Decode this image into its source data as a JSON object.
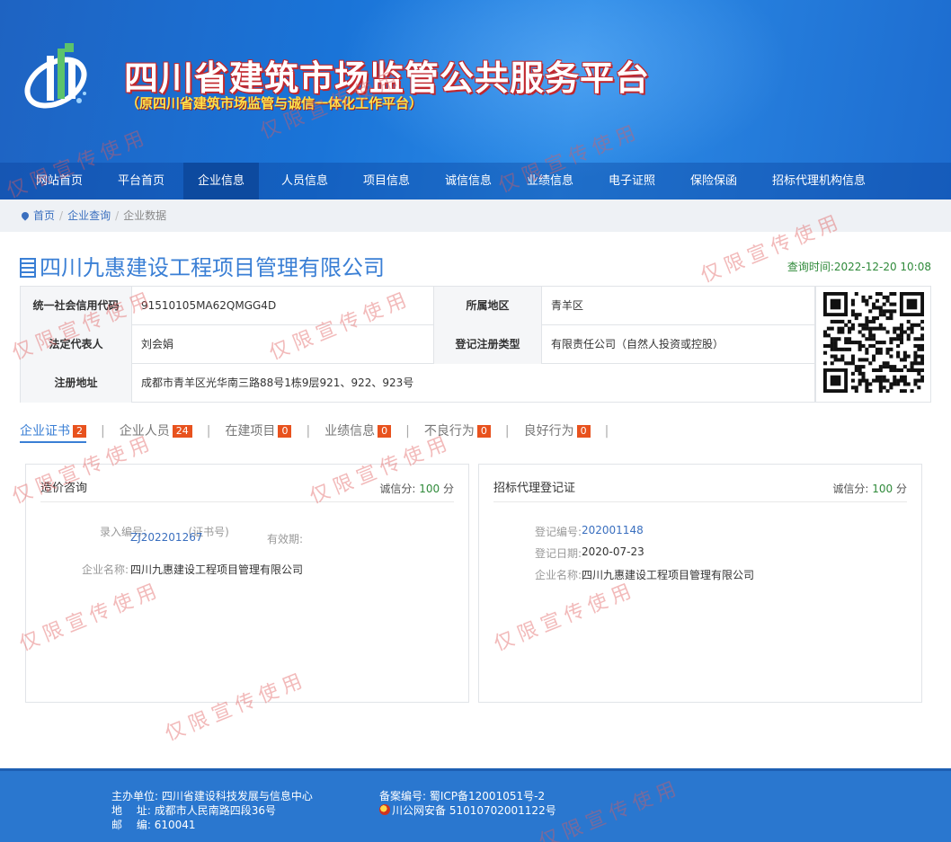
{
  "header": {
    "title": "四川省建筑市场监管公共服务平台",
    "subtitle": "（原四川省建筑市场监管与诚信一体化工作平台）"
  },
  "nav": {
    "items": [
      {
        "label": "网站首页",
        "active": false
      },
      {
        "label": "平台首页",
        "active": false
      },
      {
        "label": "企业信息",
        "active": true
      },
      {
        "label": "人员信息",
        "active": false
      },
      {
        "label": "项目信息",
        "active": false
      },
      {
        "label": "诚信信息",
        "active": false
      },
      {
        "label": "业绩信息",
        "active": false
      },
      {
        "label": "电子证照",
        "active": false
      },
      {
        "label": "保险保函",
        "active": false
      },
      {
        "label": "招标代理机构信息",
        "active": false
      }
    ]
  },
  "breadcrumb": {
    "home": "首页",
    "query": "企业查询",
    "current": "企业数据",
    "separator": "/"
  },
  "company": {
    "name": "四川九惠建设工程项目管理有限公司",
    "query_time": "查询时间:2022-12-20 10:08"
  },
  "info": {
    "credit_code_label": "统一社会信用代码",
    "credit_code": "91510105MA62QMGG4D",
    "region_label": "所属地区",
    "region": "青羊区",
    "legal_rep_label": "法定代表人",
    "legal_rep": "刘会娟",
    "reg_type_label": "登记注册类型",
    "reg_type": "有限责任公司（自然人投资或控股）",
    "address_label": "注册地址",
    "address": "成都市青羊区光华南三路88号1栋9层921、922、923号"
  },
  "tabs": [
    {
      "label": "企业证书",
      "count": "2",
      "active": true
    },
    {
      "label": "企业人员",
      "count": "24",
      "active": false
    },
    {
      "label": "在建项目",
      "count": "0",
      "active": false
    },
    {
      "label": "业绩信息",
      "count": "0",
      "active": false
    },
    {
      "label": "不良行为",
      "count": "0",
      "active": false
    },
    {
      "label": "良好行为",
      "count": "0",
      "active": false
    }
  ],
  "tab_separator": "|",
  "cards": {
    "left": {
      "title": "造价咨询",
      "score_label": "诚信分:",
      "score": "100",
      "score_unit": "分",
      "entry_no_label": "录入编号:",
      "cert_no_label": "(证书号)",
      "entry_no": "ZJ202201267",
      "validity_label": "有效期:",
      "company_label": "企业名称:",
      "company": "四川九惠建设工程项目管理有限公司"
    },
    "right": {
      "title": "招标代理登记证",
      "score_label": "诚信分:",
      "score": "100",
      "score_unit": "分",
      "reg_no_label": "登记编号:",
      "reg_no": "202001148",
      "reg_date_label": "登记日期:",
      "reg_date": "2020-07-23",
      "company_label": "企业名称:",
      "company": "四川九惠建设工程项目管理有限公司"
    }
  },
  "footer": {
    "host_label": "主办单位:",
    "host": "四川省建设科技发展与信息中心",
    "address_label": "地　 址:",
    "address": "成都市人民南路四段36号",
    "zip_label": "邮　 编:",
    "zip": "610041",
    "icp_label": "备案编号:",
    "icp": "蜀ICP备12001051号-2",
    "police": "川公网安备 51010702001122号"
  },
  "watermark": "仅限宣传使用",
  "colors": {
    "brand_blue": "#1a74d8",
    "link_blue": "#3a7fd5",
    "badge_orange": "#e8521e",
    "score_green": "#2f8a3a",
    "watermark_red": "#e15a5a"
  }
}
